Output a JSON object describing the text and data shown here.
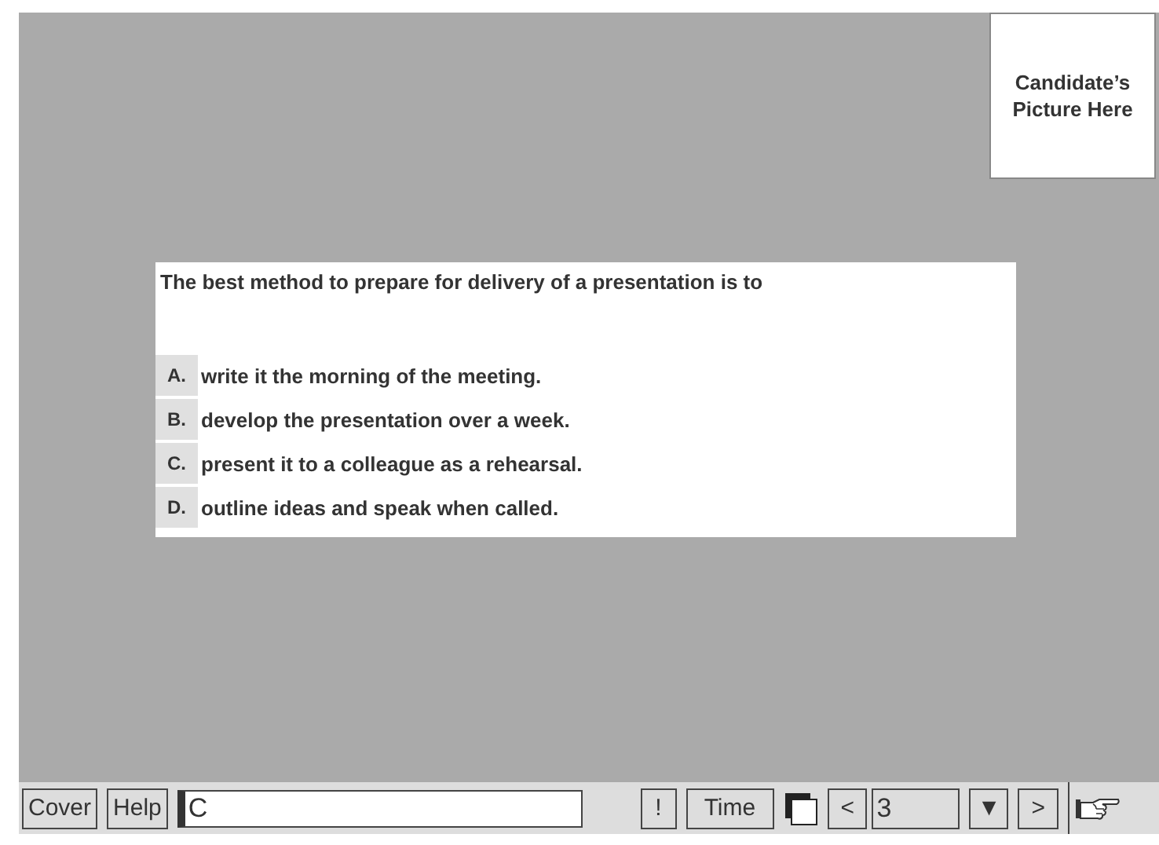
{
  "candidate_picture": {
    "label": "Candidate’s Picture Here"
  },
  "question": {
    "text": "The best method to prepare for delivery of a presentation is to",
    "options": [
      {
        "letter": "A.",
        "text": "write it the morning of the meeting."
      },
      {
        "letter": "B.",
        "text": "develop the presentation over a week."
      },
      {
        "letter": "C.",
        "text": "present it to a colleague as a rehearsal."
      },
      {
        "letter": "D.",
        "text": "outline ideas and speak when called."
      }
    ]
  },
  "toolbar": {
    "cover": "Cover",
    "help": "Help",
    "answer": "C",
    "flag": "!",
    "time": "Time",
    "prev": "<",
    "page": "3",
    "dropdown": "▼",
    "next": ">"
  }
}
